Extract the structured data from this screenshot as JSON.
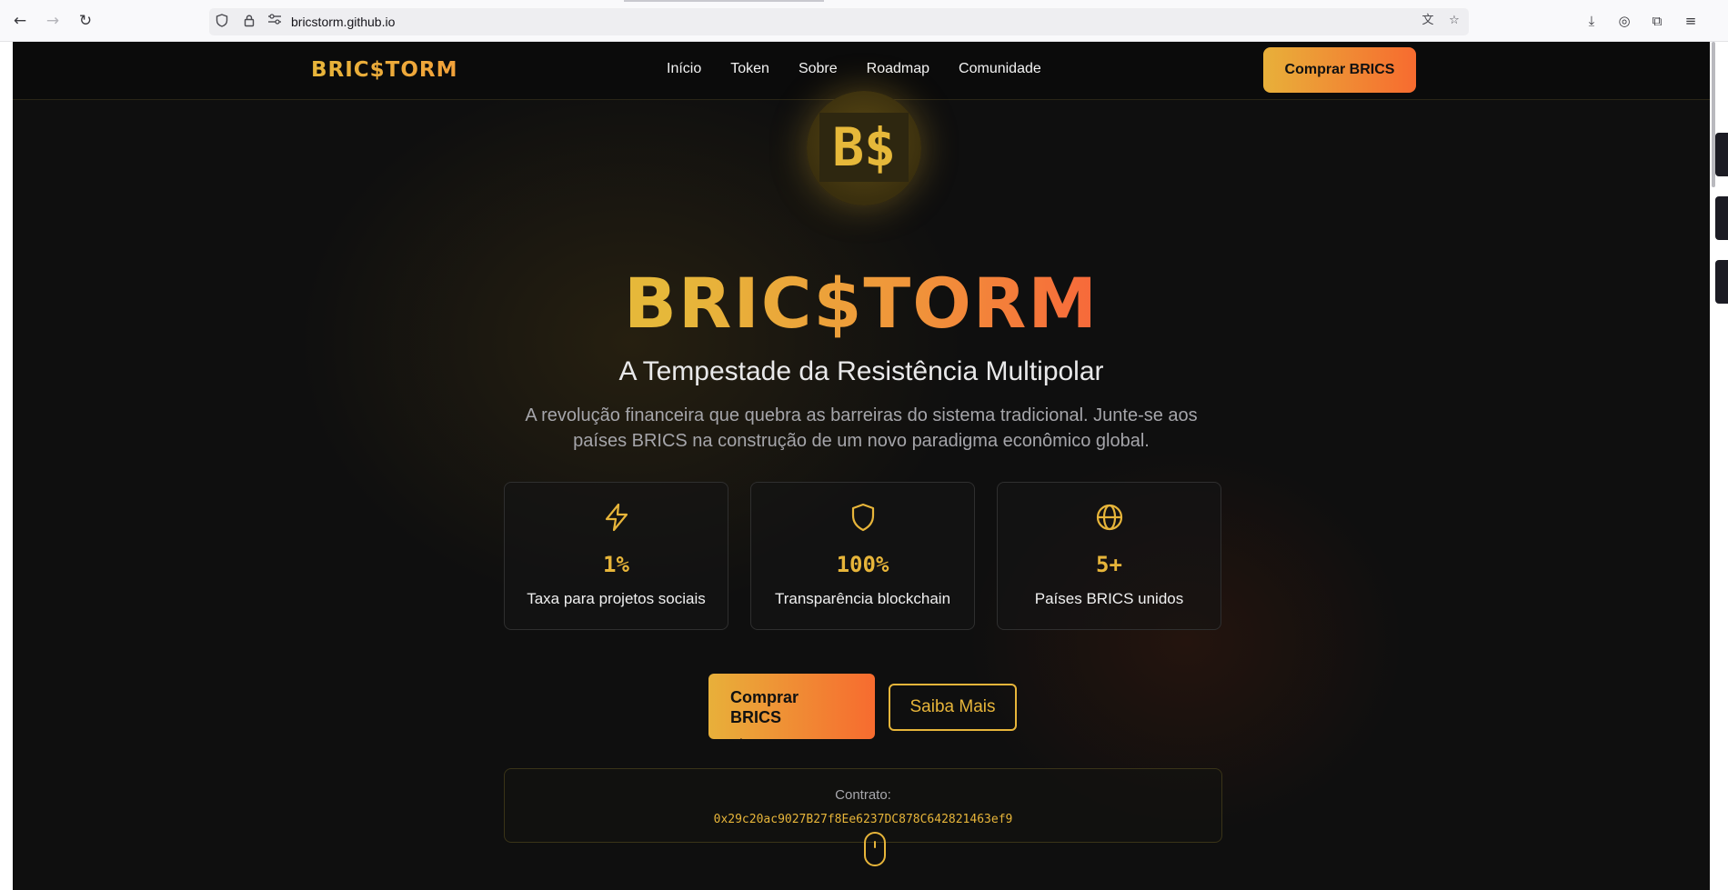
{
  "browser": {
    "url": "bricstorm.github.io",
    "icons": {
      "back": "arrow-left-icon",
      "forward": "arrow-right-icon",
      "reload": "reload-icon",
      "shield": "shield-icon",
      "lock": "lock-icon",
      "site_info": "site-info-icon",
      "translate": "translate-icon",
      "bookmark": "star-icon",
      "downloads": "download-icon",
      "account": "account-icon",
      "extensions": "extensions-icon",
      "menu": "hamburger-menu-icon"
    }
  },
  "site": {
    "brand": "BRIC$TORM",
    "nav": [
      "Início",
      "Token",
      "Sobre",
      "Roadmap",
      "Comunidade"
    ],
    "nav_cta": "Comprar BRICS"
  },
  "hero": {
    "logo_text": "B$",
    "title": "BRIC$TORM",
    "subtitle": "A Tempestade da Resistência Multipolar",
    "description": "A revolução financeira que quebra as barreiras do sistema tradicional. Junte-se aos países BRICS na construção de um novo paradigma econômico global."
  },
  "stats": [
    {
      "icon": "lightning-icon",
      "value": "1%",
      "label": "Taxa para projetos sociais"
    },
    {
      "icon": "shield-icon",
      "value": "100%",
      "label": "Transparência blockchain"
    },
    {
      "icon": "globe-icon",
      "value": "5+",
      "label": "Países BRICS unidos"
    }
  ],
  "buttons": {
    "buy": "Comprar BRICS",
    "buy_arrow": "→",
    "more": "Saiba Mais"
  },
  "contract": {
    "label": "Contrato:",
    "address": "0x29c20ac9027B27f8Ee6237DC878C642821463ef9"
  },
  "colors": {
    "gold": "#e7b53a",
    "orange": "#f76b2f",
    "background": "#0f0f0f"
  }
}
